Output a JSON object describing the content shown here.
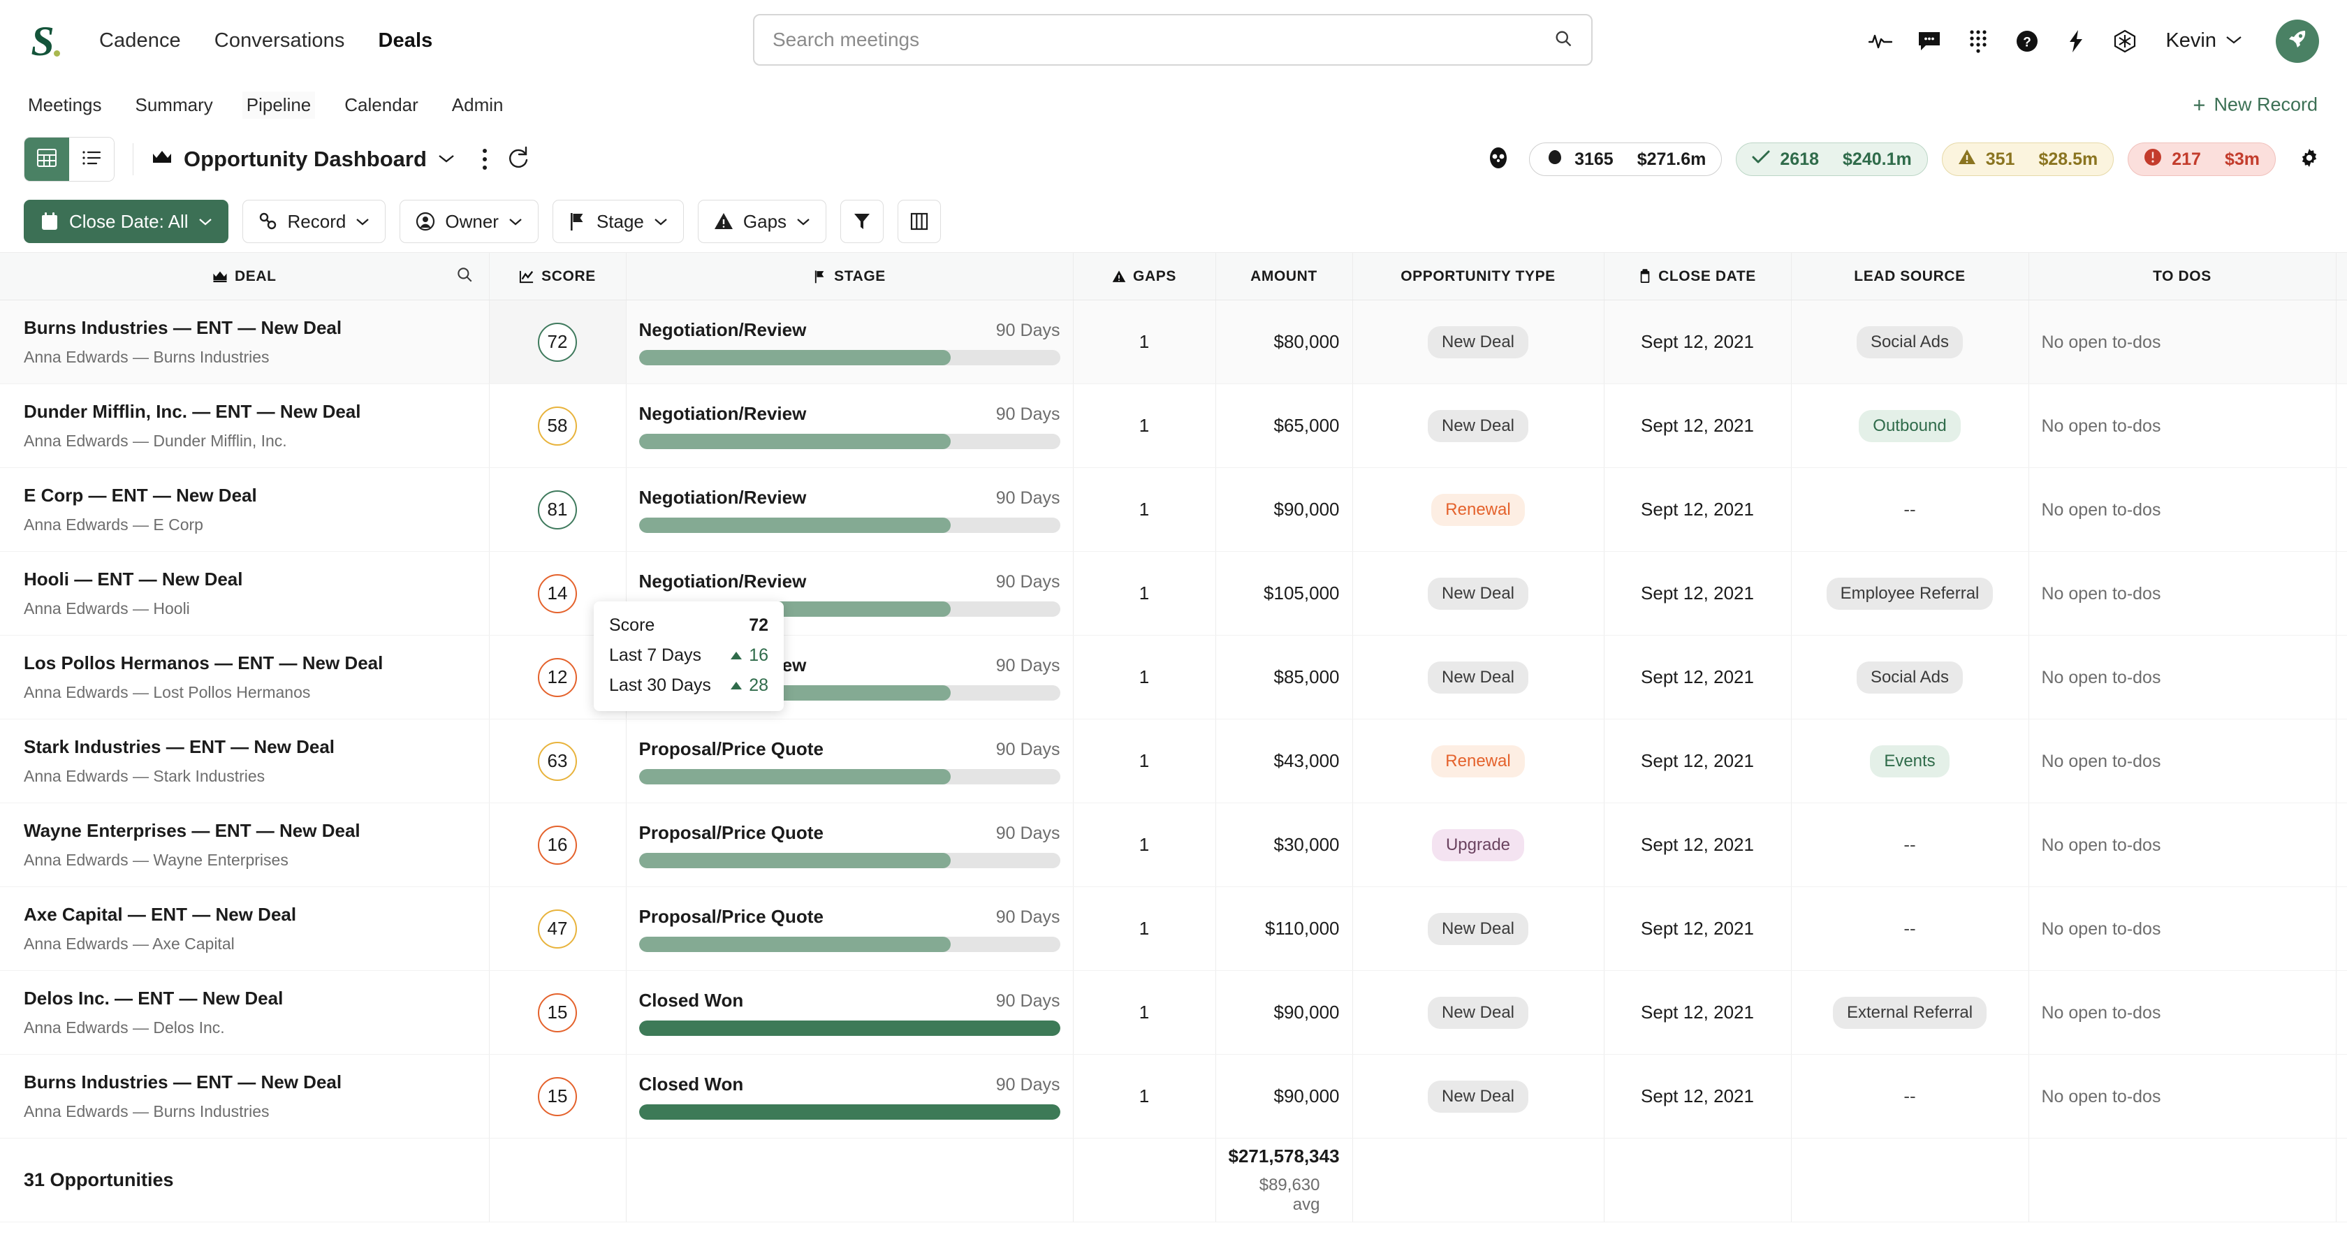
{
  "brand": {
    "logo_letter": "S",
    "accent": "#3c7055",
    "logo_color": "#14543a"
  },
  "topnav": {
    "items": [
      {
        "label": "Cadence",
        "active": false
      },
      {
        "label": "Conversations",
        "active": false
      },
      {
        "label": "Deals",
        "active": true
      }
    ],
    "search": {
      "value": "",
      "placeholder": "Search meetings",
      "icon": "search-icon"
    },
    "icons": [
      "activity-icon",
      "chat-icon",
      "dialpad-icon",
      "help-icon",
      "bolt-icon",
      "integrations-icon"
    ],
    "user": {
      "name": "Kevin",
      "chevron": "⌄"
    },
    "avatar_icon": "rocket-icon"
  },
  "subnav": {
    "items": [
      {
        "label": "Meetings",
        "active": false
      },
      {
        "label": "Summary",
        "active": false
      },
      {
        "label": "Pipeline",
        "active": false,
        "hovered": true
      },
      {
        "label": "Calendar",
        "active": false
      },
      {
        "label": "Admin",
        "active": false
      }
    ],
    "new_record": {
      "label": "New Record",
      "plus": "+"
    }
  },
  "toolbar": {
    "view_grid_icon": "grid-view-icon",
    "view_list_icon": "list-view-icon",
    "dashboard_title": "Opportunity Dashboard",
    "crown_icon": "crown-icon",
    "chevron": "⌄",
    "kebab_icon": "more-options-icon",
    "refresh_icon": "refresh-icon",
    "people_icon": "people-icon",
    "gear_icon": "settings-gear-icon",
    "stats": [
      {
        "name": "total",
        "icon": "cloud-icon",
        "count": "3165",
        "value": "$271.6m"
      },
      {
        "name": "won",
        "icon": "check-icon",
        "count": "2618",
        "value": "$240.1m"
      },
      {
        "name": "at-risk",
        "icon": "warning-icon",
        "count": "351",
        "value": "$28.5m"
      },
      {
        "name": "critical",
        "icon": "error-icon",
        "count": "217",
        "value": "$3m"
      }
    ]
  },
  "filters": {
    "buttons": [
      {
        "label": "Close Date: All",
        "icon": "calendar-icon",
        "primary": true,
        "chevron": "⌄"
      },
      {
        "label": "Record",
        "icon": "link-icon",
        "primary": false,
        "chevron": "⌄"
      },
      {
        "label": "Owner",
        "icon": "person-icon",
        "primary": false,
        "chevron": "⌄"
      },
      {
        "label": "Stage",
        "icon": "flag-icon",
        "primary": false,
        "chevron": "⌄"
      },
      {
        "label": "Gaps",
        "icon": "warning-triangle-icon",
        "primary": false,
        "chevron": "⌄"
      }
    ],
    "funnel_icon": "funnel-filter-icon",
    "columns_icon": "columns-icon"
  },
  "table": {
    "columns": [
      {
        "key": "deal",
        "label": "DEAL",
        "icon": "crown-icon",
        "search_icon": "search-icon"
      },
      {
        "key": "score",
        "label": "SCORE",
        "icon": "chart-icon"
      },
      {
        "key": "stage",
        "label": "STAGE",
        "icon": "flag-icon"
      },
      {
        "key": "gaps",
        "label": "GAPS",
        "icon": "warning-triangle-icon"
      },
      {
        "key": "amount",
        "label": "AMOUNT",
        "icon": null
      },
      {
        "key": "opportunity_type",
        "label": "OPPORTUNITY TYPE",
        "icon": null
      },
      {
        "key": "close_date",
        "label": "CLOSE DATE",
        "icon": "calendar-icon"
      },
      {
        "key": "lead_source",
        "label": "LEAD SOURCE",
        "icon": null
      },
      {
        "key": "to_dos",
        "label": "TO DOS",
        "icon": null
      }
    ],
    "rows": [
      {
        "deal": "Burns Industries — ENT — New Deal",
        "sub": "Anna Edwards — Burns Industries",
        "score": "72",
        "score_level": "hi",
        "stage": "Negotiation/Review",
        "days": "90 Days",
        "progress": 74,
        "won": false,
        "gaps": "1",
        "amount": "$80,000",
        "opportunity_type": "New Deal",
        "type_style": "gray",
        "close_date": "Sept 12, 2021",
        "lead_source": "Social Ads",
        "source_style": "gray",
        "to_dos": "No open to-dos"
      },
      {
        "deal": "Dunder Mifflin, Inc. — ENT — New Deal",
        "sub": "Anna Edwards — Dunder Mifflin, Inc.",
        "score": "58",
        "score_level": "mid",
        "stage": "Negotiation/Review",
        "days": "90 Days",
        "progress": 74,
        "won": false,
        "gaps": "1",
        "amount": "$65,000",
        "opportunity_type": "New Deal",
        "type_style": "gray",
        "close_date": "Sept 12, 2021",
        "lead_source": "Outbound",
        "source_style": "green",
        "to_dos": "No open to-dos"
      },
      {
        "deal": "E Corp — ENT — New Deal",
        "sub": "Anna Edwards — E Corp",
        "score": "81",
        "score_level": "hi",
        "stage": "Negotiation/Review",
        "days": "90 Days",
        "progress": 74,
        "won": false,
        "gaps": "1",
        "amount": "$90,000",
        "opportunity_type": "Renewal",
        "type_style": "renewal",
        "close_date": "Sept 12, 2021",
        "lead_source": "--",
        "source_style": "none",
        "to_dos": "No open to-dos"
      },
      {
        "deal": "Hooli — ENT — New Deal",
        "sub": "Anna Edwards — Hooli",
        "score": "14",
        "score_level": "low",
        "stage": "Negotiation/Review",
        "days": "90 Days",
        "progress": 74,
        "won": false,
        "gaps": "1",
        "amount": "$105,000",
        "opportunity_type": "New Deal",
        "type_style": "gray",
        "close_date": "Sept 12, 2021",
        "lead_source": "Employee Referral",
        "source_style": "gray",
        "to_dos": "No open to-dos"
      },
      {
        "deal": "Los Pollos Hermanos — ENT — New Deal",
        "sub": "Anna Edwards — Lost Pollos Hermanos",
        "score": "12",
        "score_level": "low",
        "stage": "Negotiation/Review",
        "days": "90 Days",
        "progress": 74,
        "won": false,
        "gaps": "1",
        "amount": "$85,000",
        "opportunity_type": "New Deal",
        "type_style": "gray",
        "close_date": "Sept 12, 2021",
        "lead_source": "Social Ads",
        "source_style": "gray",
        "to_dos": "No open to-dos"
      },
      {
        "deal": "Stark Industries — ENT — New Deal",
        "sub": "Anna Edwards — Stark Industries",
        "score": "63",
        "score_level": "mid",
        "stage": "Proposal/Price Quote",
        "days": "90 Days",
        "progress": 74,
        "won": false,
        "gaps": "1",
        "amount": "$43,000",
        "opportunity_type": "Renewal",
        "type_style": "renewal",
        "close_date": "Sept 12, 2021",
        "lead_source": "Events",
        "source_style": "green",
        "to_dos": "No open to-dos"
      },
      {
        "deal": "Wayne Enterprises — ENT — New Deal",
        "sub": "Anna Edwards — Wayne Enterprises",
        "score": "16",
        "score_level": "low",
        "stage": "Proposal/Price Quote",
        "days": "90 Days",
        "progress": 74,
        "won": false,
        "gaps": "1",
        "amount": "$30,000",
        "opportunity_type": "Upgrade",
        "type_style": "upgrade",
        "close_date": "Sept 12, 2021",
        "lead_source": "--",
        "source_style": "none",
        "to_dos": "No open to-dos"
      },
      {
        "deal": "Axe Capital — ENT — New Deal",
        "sub": "Anna Edwards — Axe Capital",
        "score": "47",
        "score_level": "mid",
        "stage": "Proposal/Price Quote",
        "days": "90 Days",
        "progress": 74,
        "won": false,
        "gaps": "1",
        "amount": "$110,000",
        "opportunity_type": "New Deal",
        "type_style": "gray",
        "close_date": "Sept 12, 2021",
        "lead_source": "--",
        "source_style": "none",
        "to_dos": "No open to-dos"
      },
      {
        "deal": "Delos Inc. — ENT — New Deal",
        "sub": "Anna Edwards — Delos Inc.",
        "score": "15",
        "score_level": "low",
        "stage": "Closed Won",
        "days": "90 Days",
        "progress": 100,
        "won": true,
        "gaps": "1",
        "amount": "$90,000",
        "opportunity_type": "New Deal",
        "type_style": "gray",
        "close_date": "Sept 12, 2021",
        "lead_source": "External Referral",
        "source_style": "gray",
        "to_dos": "No open to-dos"
      },
      {
        "deal": "Burns Industries — ENT — New Deal",
        "sub": "Anna Edwards — Burns Industries",
        "score": "15",
        "score_level": "low",
        "stage": "Closed Won",
        "days": "90 Days",
        "progress": 100,
        "won": true,
        "gaps": "1",
        "amount": "$90,000",
        "opportunity_type": "New Deal",
        "type_style": "gray",
        "close_date": "Sept 12, 2021",
        "lead_source": "--",
        "source_style": "none",
        "to_dos": "No open to-dos"
      }
    ],
    "summary": {
      "label": "31 Opportunities",
      "amount_total": "$271,578,343",
      "amount_avg": "$89,630 avg"
    }
  },
  "tooltip": {
    "title_label": "Score",
    "title_value": "72",
    "rows": [
      {
        "label": "Last 7 Days",
        "delta": "16",
        "direction": "up"
      },
      {
        "label": "Last 30 Days",
        "delta": "28",
        "direction": "up"
      }
    ]
  }
}
